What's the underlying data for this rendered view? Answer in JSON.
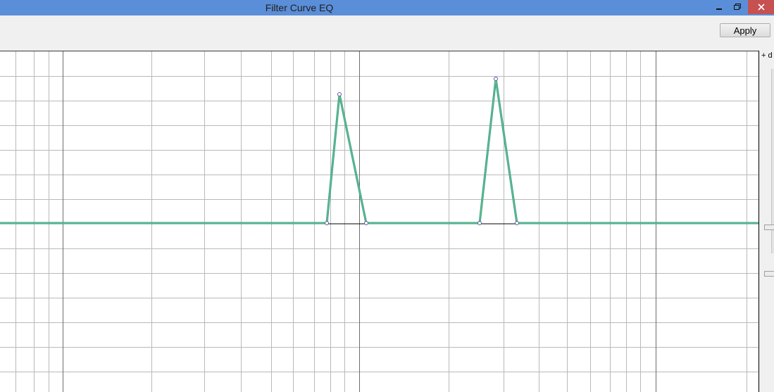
{
  "window": {
    "title": "Filter Curve EQ",
    "controls": {
      "minimize_icon": "minimize-icon",
      "restore_icon": "restore-icon",
      "close_icon": "close-icon"
    },
    "titlebar_color": "#5b8ed8",
    "close_color": "#c75050"
  },
  "toolbar": {
    "apply_label": "Apply"
  },
  "right_panel": {
    "db_label": "+ d"
  },
  "eq_graph": {
    "curve_color": "#3aa07a",
    "grid_color": "#b4b4b4",
    "baseline_color": "#000000"
  }
}
